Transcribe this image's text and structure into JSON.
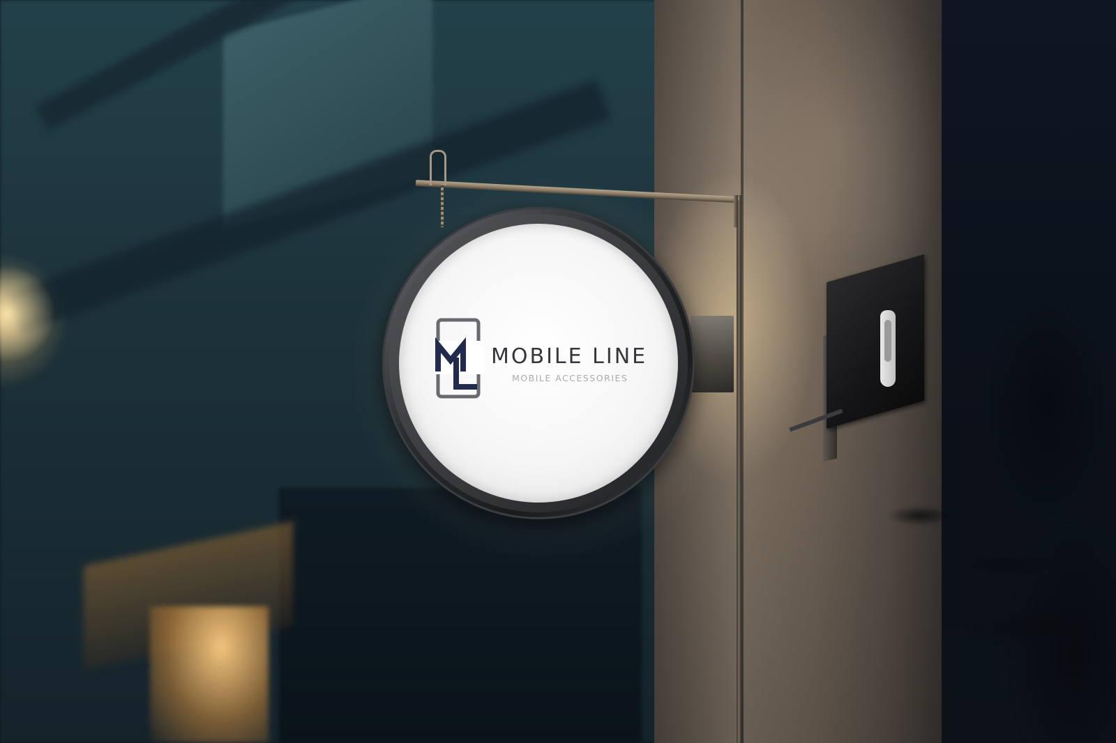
{
  "sign": {
    "brand_name": "MOBILE LINE",
    "tagline": "MOBILE ACCESSORIES",
    "logo_letters": "ML"
  },
  "colors": {
    "logo_navy": "#222a4e",
    "logo_frame": "#686a70",
    "text_dark": "#34363d",
    "text_light": "#a9abb0"
  }
}
